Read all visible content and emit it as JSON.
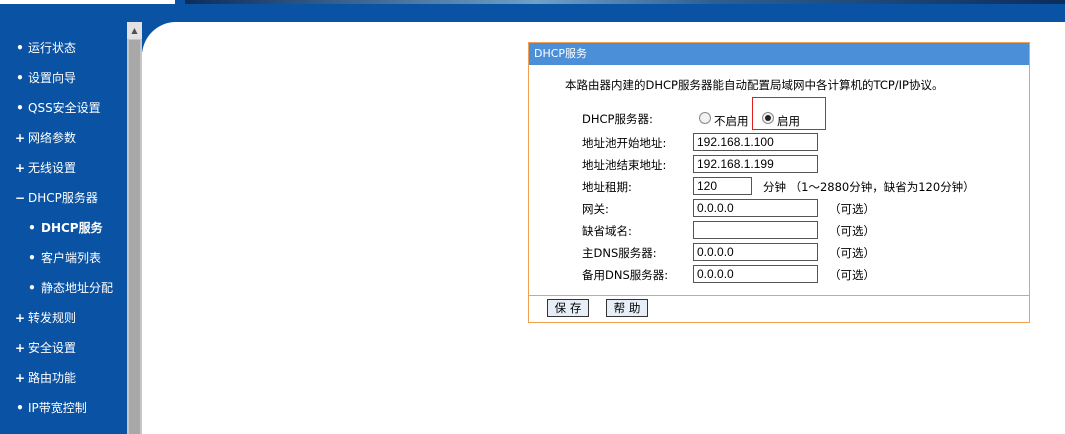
{
  "sidebar": {
    "items": [
      {
        "mark": "•",
        "label": "运行状态"
      },
      {
        "mark": "•",
        "label": "设置向导"
      },
      {
        "mark": "•",
        "label": "QSS安全设置"
      },
      {
        "mark": "+",
        "label": "网络参数"
      },
      {
        "mark": "+",
        "label": "无线设置"
      },
      {
        "mark": "−",
        "label": "DHCP服务器"
      },
      {
        "mark": "•",
        "label": "DHCP服务"
      },
      {
        "mark": "•",
        "label": "客户端列表"
      },
      {
        "mark": "•",
        "label": "静态地址分配"
      },
      {
        "mark": "+",
        "label": "转发规则"
      },
      {
        "mark": "+",
        "label": "安全设置"
      },
      {
        "mark": "+",
        "label": "路由功能"
      },
      {
        "mark": "•",
        "label": "IP带宽控制"
      }
    ]
  },
  "panel": {
    "title": "DHCP服务",
    "description": "本路由器内建的DHCP服务器能自动配置局域网中各计算机的TCP/IP协议。",
    "dhcp_server_label": "DHCP服务器:",
    "disable_label": "不启用",
    "enable_label": "启用",
    "enabled": true,
    "start_label": "地址池开始地址:",
    "start_value": "192.168.1.100",
    "end_label": "地址池结束地址:",
    "end_value": "192.168.1.199",
    "lease_label": "地址租期:",
    "lease_value": "120",
    "lease_hint": "分钟 （1～2880分钟，缺省为120分钟）",
    "gateway_label": "网关:",
    "gateway_value": "0.0.0.0",
    "domain_label": "缺省域名:",
    "domain_value": "",
    "dns1_label": "主DNS服务器:",
    "dns1_value": "0.0.0.0",
    "dns2_label": "备用DNS服务器:",
    "dns2_value": "0.0.0.0",
    "optional_hint": "（可选）",
    "save_button": "保 存",
    "help_button": "帮 助"
  },
  "colors": {
    "nav_blue": "#0a52a3",
    "panel_title": "#4a8fd8",
    "panel_border": "#f0a050",
    "highlight": "#e02020"
  }
}
